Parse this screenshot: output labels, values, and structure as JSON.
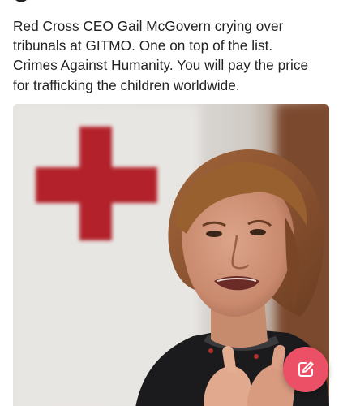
{
  "post": {
    "lines": [
      "Red Cross CEO Gail McGovern crying over",
      "tribunals at GITMO. One on top of the list.",
      "Crimes Against Humanity. You will pay the price",
      "for trafficking the children worldwide."
    ]
  },
  "photo": {
    "subject": "woman-speaking-in-front-of-red-cross-flag"
  },
  "fab": {
    "icon": "compose-icon",
    "color": "#ec5067"
  },
  "colors": {
    "text": "#222222",
    "red_cross": "#b3212a",
    "fab": "#ec5067"
  }
}
